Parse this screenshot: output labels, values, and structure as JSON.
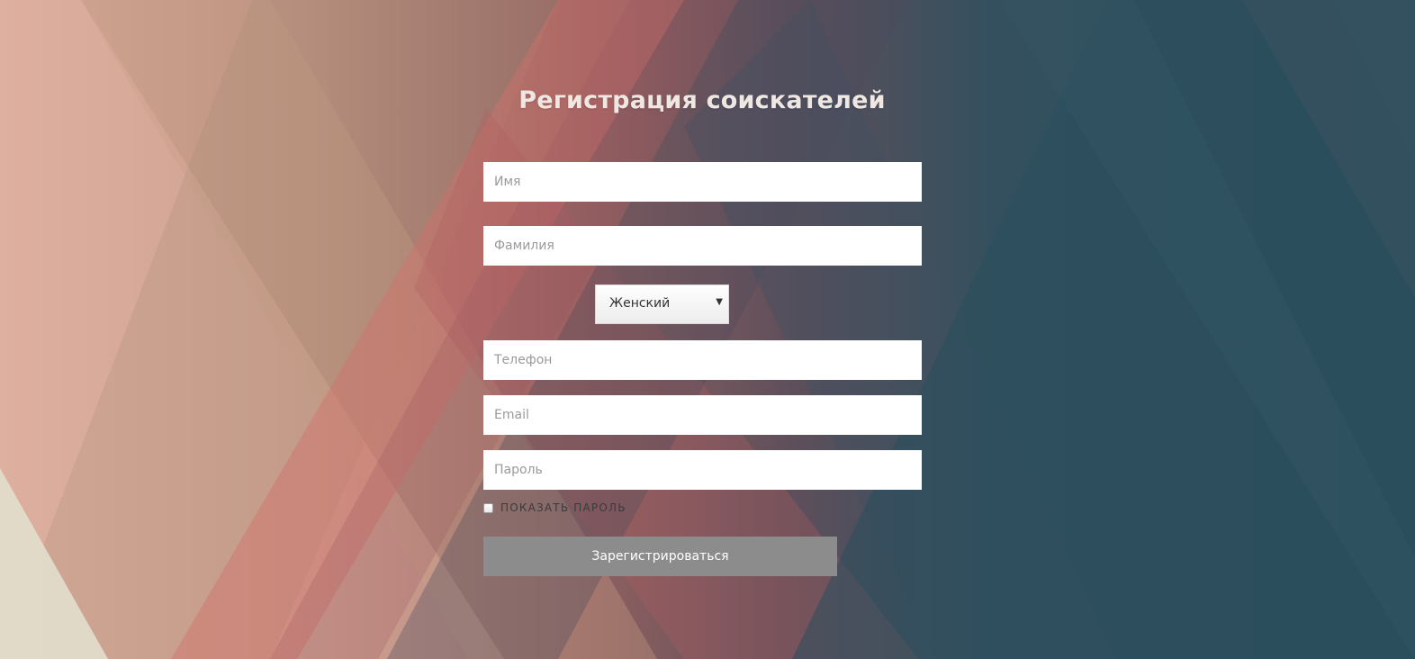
{
  "colors": {
    "title_text": "#efe7e1",
    "field_background": "#ffffff",
    "placeholder_text": "#9a9a9a",
    "button_background": "#8c8c8c",
    "button_text": "#ffffff"
  },
  "title": "Регистрация соискателей",
  "form": {
    "first_name": {
      "placeholder": "Имя",
      "value": ""
    },
    "last_name": {
      "placeholder": "Фамилия",
      "value": ""
    },
    "gender": {
      "selected": "Женский",
      "icon": "dropdown-arrow"
    },
    "phone": {
      "placeholder": "Телефон",
      "value": ""
    },
    "email": {
      "placeholder": "Email",
      "value": ""
    },
    "password": {
      "placeholder": "Пароль",
      "value": ""
    },
    "show_password": {
      "label": "ПОКАЗАТЬ ПАРОЛЬ",
      "checked": false
    },
    "submit_label": "Зарегистрироваться"
  }
}
